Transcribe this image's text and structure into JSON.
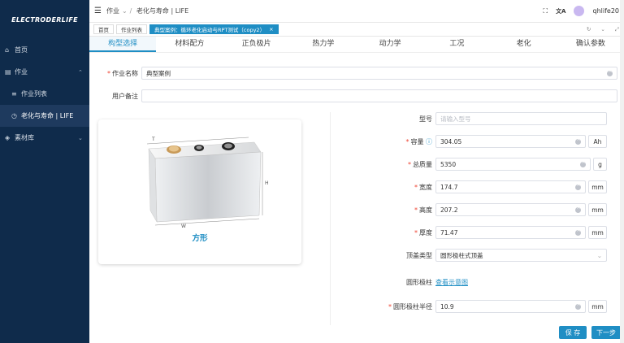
{
  "sidebar": {
    "logo": "ELECTRODERLIFE",
    "items": [
      {
        "icon": "⌂",
        "label": "首页"
      },
      {
        "icon": "▤",
        "label": "作业"
      },
      {
        "icon": "≡",
        "label": "作业列表"
      },
      {
        "icon": "◷",
        "label": "老化与寿命 | LIFE"
      },
      {
        "icon": "◈",
        "label": "素材库"
      }
    ]
  },
  "header": {
    "menu_icon": "☰",
    "breadcrumb": [
      "作业",
      "老化与寿命 | LIFE"
    ],
    "user": "qhlife20",
    "fullscreen_icon": "⛶",
    "lang_icon": "文A"
  },
  "tags": {
    "items": [
      "首页",
      "作业列表",
      "典型案例：循环老化启动与RPT测试（copy2）"
    ],
    "active_index": 2,
    "close": "×",
    "refresh": "↻",
    "down": "⌄",
    "fold": "⤢"
  },
  "steps": [
    "构型选择",
    "材料配方",
    "正负极片",
    "热力学",
    "动力学",
    "工况",
    "老化",
    "确认参数"
  ],
  "form": {
    "job_name_label": "作业名称",
    "job_name": "典型案例",
    "remark_label": "用户备注",
    "remark": ""
  },
  "card": {
    "caption": "方形",
    "dims": {
      "t": "T",
      "h": "H",
      "w": "W"
    }
  },
  "params": {
    "model_label": "型号",
    "model_placeholder": "请输入型号",
    "capacity_label": "容量",
    "capacity": "304.05",
    "capacity_unit": "Ah",
    "mass_label": "总质量",
    "mass": "5350",
    "mass_unit": "g",
    "width_label": "宽度",
    "width": "174.7",
    "width_unit": "mm",
    "height_label": "高度",
    "height": "207.2",
    "height_unit": "mm",
    "thick_label": "厚度",
    "thick": "71.47",
    "thick_unit": "mm",
    "cover_label": "顶盖类型",
    "cover": "圆形极柱式顶盖",
    "pole_label": "圆形极柱",
    "pole_link": "查看示意图",
    "pole_r_label": "圆形极柱半径",
    "pole_r": "10.9",
    "pole_r_unit": "mm"
  },
  "buttons": {
    "save": "保 存",
    "next": "下一步"
  },
  "colors": {
    "sidebar": "#0f2b4b",
    "accent": "#1f8ec4",
    "required": "#e43"
  }
}
